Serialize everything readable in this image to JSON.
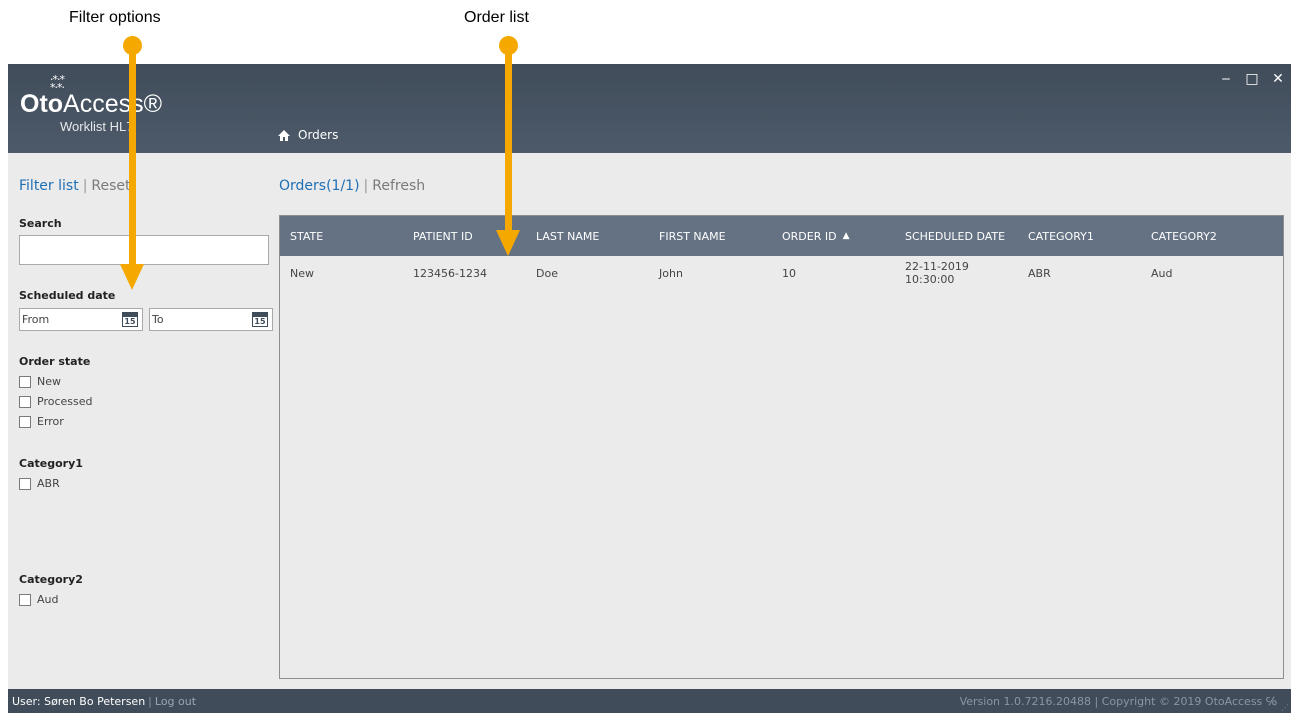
{
  "annotations": {
    "filter_label": "Filter options",
    "order_label": "Order list"
  },
  "app": {
    "logo_main_pre": "Oto",
    "logo_main_post": "Access®",
    "logo_sub": "Worklist HL7"
  },
  "breadcrumb": {
    "label": "Orders",
    "icon": "home-icon"
  },
  "window_controls": {
    "minimize": "‒",
    "maximize": "□",
    "close": "✕"
  },
  "sidebar": {
    "filter_list": "Filter list",
    "reset": "Reset",
    "search_label": "Search",
    "search_value": "",
    "scheduled_date_label": "Scheduled date",
    "from_placeholder": "From",
    "to_placeholder": "To",
    "calendar_day": "15",
    "order_state_label": "Order state",
    "order_states": [
      "New",
      "Processed",
      "Error"
    ],
    "category1_label": "Category1",
    "category1_items": [
      "ABR"
    ],
    "category2_label": "Category2",
    "category2_items": [
      "Aud"
    ]
  },
  "orders": {
    "title": "Orders(1/1)",
    "refresh": "Refresh",
    "columns": [
      "STATE",
      "PATIENT ID",
      "LAST NAME",
      "FIRST NAME",
      "ORDER ID",
      "SCHEDULED DATE",
      "CATEGORY1",
      "CATEGORY2"
    ],
    "sort_indicator": "▲",
    "rows": [
      [
        "New",
        "123456-1234",
        "Doe",
        "John",
        "10",
        "22-11-2019 10:30:00",
        "ABR",
        "Aud"
      ]
    ]
  },
  "footer": {
    "user": "User: Søren Bo Petersen",
    "logout": "Log out",
    "version": "Version 1.0.7216.20488 | Copyright © 2019 OtoAccess ℅"
  },
  "colors": {
    "header": "#404c5a",
    "table_header": "#657283",
    "link": "#1f6fb5",
    "annotation_arrow": "#f5a800"
  }
}
